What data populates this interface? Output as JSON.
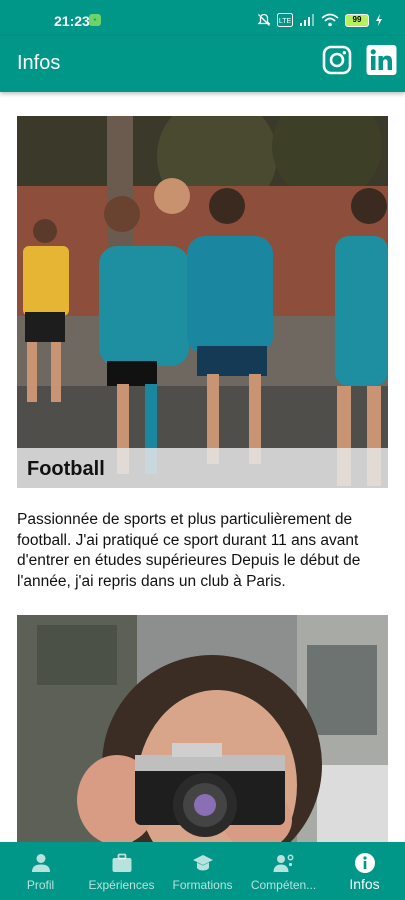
{
  "status_bar": {
    "time": "21:23",
    "battery": "99"
  },
  "app_bar": {
    "title": "Infos"
  },
  "cards": [
    {
      "caption": "Football"
    }
  ],
  "description": "Passionnée de sports et plus particulièrement de football. J'ai pratiqué ce sport durant 11 ans avant d'entrer en études supérieures  Depuis le début de l'année, j'ai repris dans un club à Paris.",
  "bottom_nav": {
    "items": [
      {
        "label": "Profil",
        "icon": "person-icon"
      },
      {
        "label": "Expériences",
        "icon": "briefcase-icon"
      },
      {
        "label": "Formations",
        "icon": "graduation-cap-icon"
      },
      {
        "label": "Compéten...",
        "icon": "skills-icon"
      },
      {
        "label": "Infos",
        "icon": "info-icon"
      }
    ],
    "active_index": 4
  },
  "colors": {
    "primary": "#009688",
    "active_nav": "#ffffff"
  }
}
